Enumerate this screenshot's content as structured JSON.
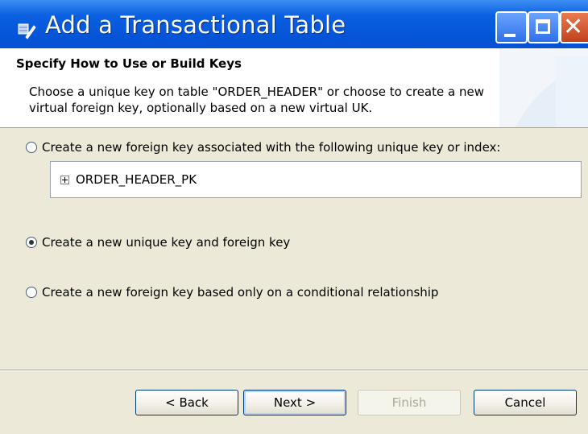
{
  "window": {
    "title": "Add a Transactional Table",
    "controls": {
      "minimize_icon": "minimize-icon",
      "maximize_icon": "maximize-icon",
      "close_glyph": "✕"
    }
  },
  "header": {
    "title": "Specify How to Use or Build Keys",
    "description": "Choose a unique key on table \"ORDER_HEADER\" or choose to create a new virtual foreign key, optionally based on a new virtual UK."
  },
  "options": {
    "existing_key": {
      "label": "Create a new foreign key associated with the following unique key or index:",
      "checked": false
    },
    "key_list": {
      "items": [
        "ORDER_HEADER_PK"
      ]
    },
    "new_unique": {
      "label": "Create a new unique key and foreign key",
      "checked": true
    },
    "conditional": {
      "label": "Create a new foreign key based only on a conditional relationship",
      "checked": false
    }
  },
  "buttons": {
    "back": "< Back",
    "next": "Next >",
    "finish": "Finish",
    "cancel": "Cancel"
  }
}
